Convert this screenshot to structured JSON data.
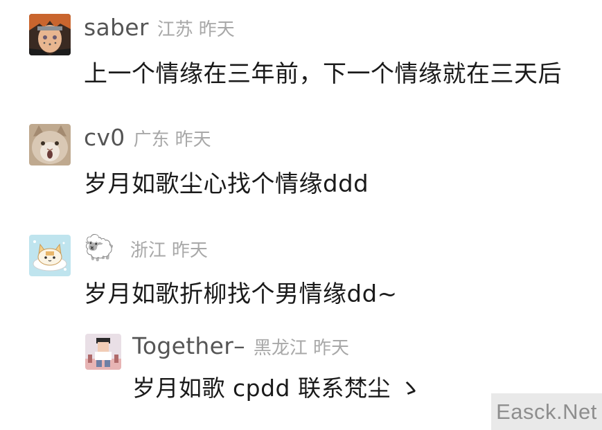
{
  "comments": [
    {
      "username": "saber",
      "location": "江苏",
      "time": "昨天",
      "text": "上一个情缘在三年前，下一个情缘就在三天后",
      "avatar_icon": "anime-character-avatar"
    },
    {
      "username": "cv0",
      "location": "广东",
      "time": "昨天",
      "text": "岁月如歌尘心找个情缘ddd",
      "avatar_icon": "cat-avatar"
    },
    {
      "username_icon": "sheep-emoji",
      "username_glyph": "🐑",
      "location": "浙江",
      "time": "昨天",
      "text": "岁月如歌折柳找个男情缘dd~",
      "avatar_icon": "cartoon-cat-avatar"
    }
  ],
  "reply": {
    "username": "Together–",
    "location": "黑龙江",
    "time": "昨天",
    "text": "岁月如歌 cpdd 联系梵尘 ゝ",
    "avatar_icon": "pixel-art-avatar"
  },
  "watermark": "Easck.Net"
}
